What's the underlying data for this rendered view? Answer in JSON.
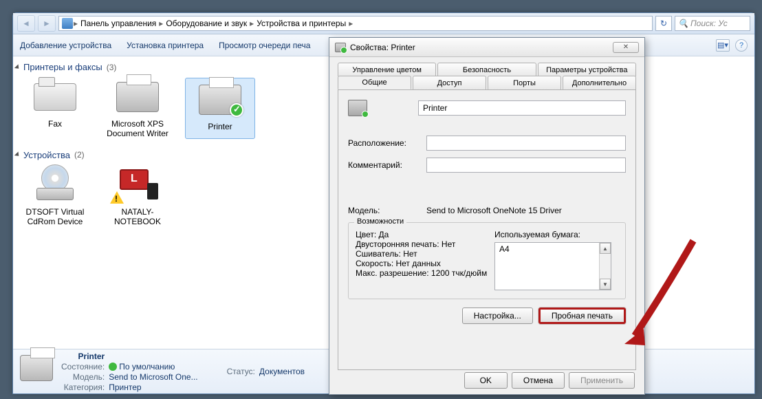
{
  "breadcrumb": {
    "seg1": "Панель управления",
    "seg2": "Оборудование и звук",
    "seg3": "Устройства и принтеры"
  },
  "search_placeholder": "Поиск: Ус",
  "toolbar": {
    "add_device": "Добавление устройства",
    "add_printer": "Установка принтера",
    "view_queue": "Просмотр очереди печа"
  },
  "cat1": {
    "title": "Принтеры и факсы",
    "count": "(3)"
  },
  "cat2": {
    "title": "Устройства",
    "count": "(2)"
  },
  "items1": [
    {
      "label": "Fax"
    },
    {
      "label": "Microsoft XPS Document Writer"
    },
    {
      "label": "Printer"
    }
  ],
  "items2": [
    {
      "label": "DTSOFT Virtual CdRom Device"
    },
    {
      "label": "NATALY-NOTEBOOK"
    }
  ],
  "details": {
    "name": "Printer",
    "state_k": "Состояние:",
    "state_v": "По умолчанию",
    "status_k": "Статус:",
    "status_v": "Документов",
    "model_k": "Модель:",
    "model_v": "Send to Microsoft One...",
    "cat_k": "Категория:",
    "cat_v": "Принтер"
  },
  "dlg": {
    "title": "Свойства: Printer",
    "tabs_top": [
      "Управление цветом",
      "Безопасность",
      "Параметры устройства"
    ],
    "tabs_bot": [
      "Общие",
      "Доступ",
      "Порты",
      "Дополнительно"
    ],
    "name_value": "Printer",
    "loc_label": "Расположение:",
    "comment_label": "Комментарий:",
    "model_label": "Модель:",
    "model_value": "Send to Microsoft OneNote 15 Driver",
    "caps_title": "Возможности",
    "color": "Цвет: Да",
    "duplex": "Двусторонняя печать: Нет",
    "staple": "Сшиватель: Нет",
    "speed": "Скорость: Нет данных",
    "maxres": "Макс. разрешение: 1200 тчк/дюйм",
    "paper_label": "Используемая бумага:",
    "paper_value": "A4",
    "btn_pref": "Настройка...",
    "btn_test": "Пробная печать",
    "btn_ok": "OK",
    "btn_cancel": "Отмена",
    "btn_apply": "Применить"
  }
}
